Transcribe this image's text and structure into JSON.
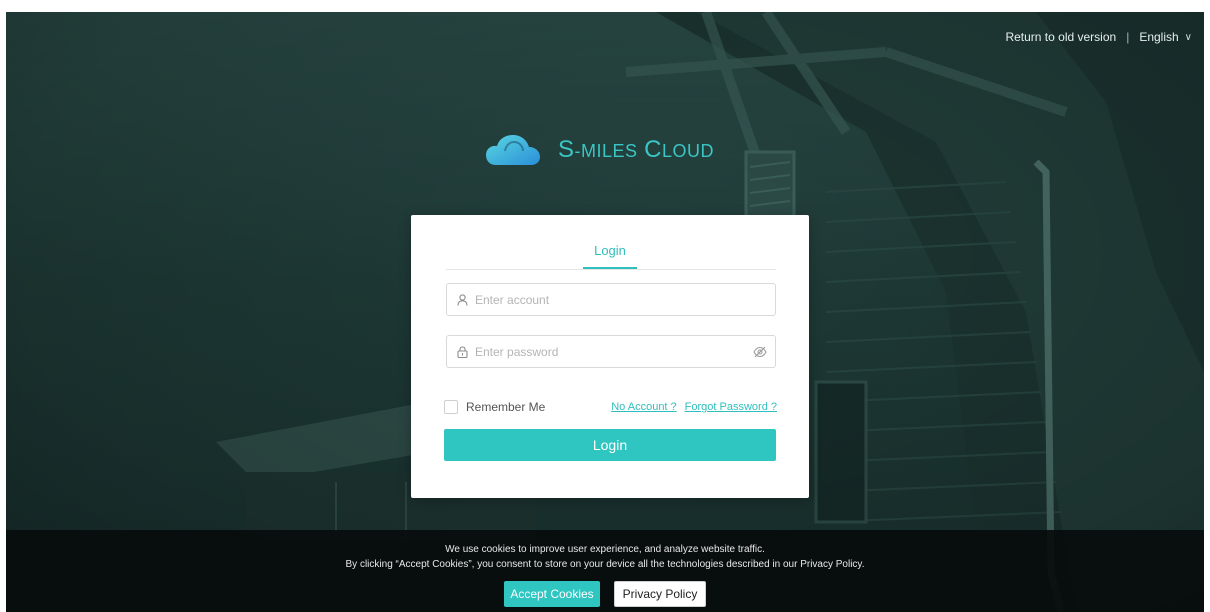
{
  "topbar": {
    "return_label": "Return to old version",
    "separator": "|",
    "language": "English",
    "chevron": "∨"
  },
  "brand": {
    "logo_icon": "cloud-icon",
    "name_s": "S",
    "name_rest": "-MILES",
    "name_c": "C",
    "name_rest2": "LOUD"
  },
  "login_card": {
    "tab_label": "Login",
    "account_placeholder": "Enter account",
    "password_placeholder": "Enter password",
    "remember_label": "Remember Me",
    "no_account_link": "No Account ?",
    "forgot_link": "Forgot Password ?",
    "submit_label": "Login",
    "icons": [
      "user-icon",
      "lock-icon",
      "eye-off-icon"
    ]
  },
  "cookie_banner": {
    "line1": "We use cookies to improve user experience, and analyze website traffic.",
    "line2": "By clicking “Accept Cookies”, you consent to store on your device all the technologies described in our Privacy Policy.",
    "accept_label": "Accept Cookies",
    "privacy_label": "Privacy Policy"
  },
  "colors": {
    "accent": "#2fc5c1",
    "brand_text": "#39c6c4",
    "background_tint": "#1f3b38"
  }
}
